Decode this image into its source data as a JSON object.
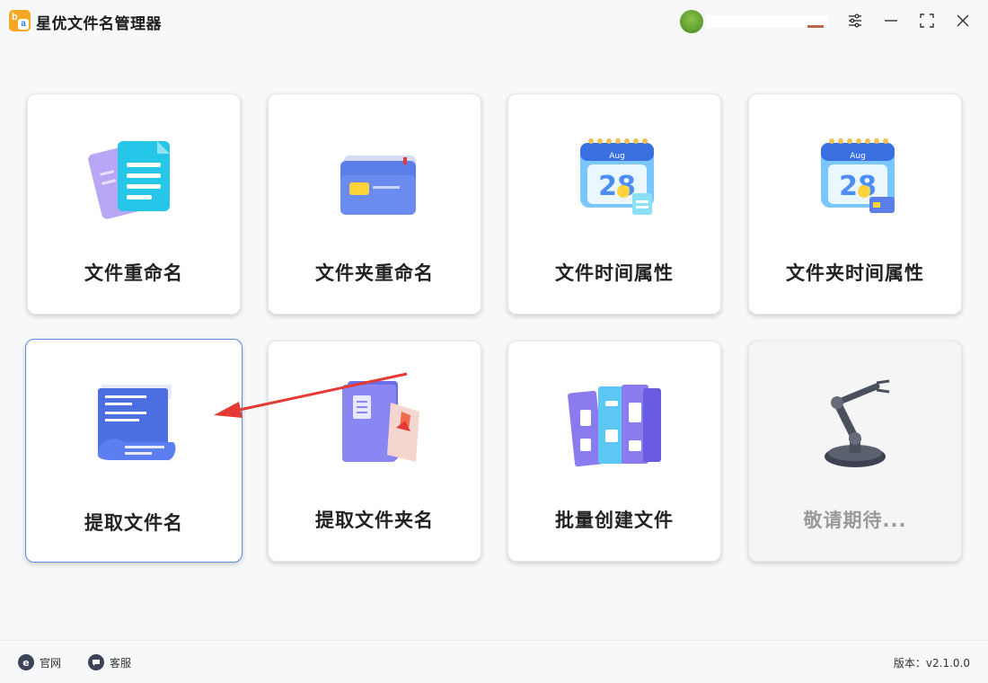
{
  "app": {
    "title": "星优文件名管理器",
    "logo_icon": "app-logo-icon"
  },
  "window_controls": [
    {
      "name": "settings",
      "icon": "sliders-icon"
    },
    {
      "name": "minimize",
      "icon": "minimize-icon"
    },
    {
      "name": "maximize",
      "icon": "maximize-icon"
    },
    {
      "name": "close",
      "icon": "close-icon"
    }
  ],
  "cards": [
    {
      "label": "文件重命名",
      "icon": "documents-icon"
    },
    {
      "label": "文件夹重命名",
      "icon": "folder-icon"
    },
    {
      "label": "文件时间属性",
      "icon": "calendar-file-icon",
      "calendar_month": "Aug",
      "calendar_day": "28"
    },
    {
      "label": "文件夹时间属性",
      "icon": "calendar-folder-icon",
      "calendar_month": "Aug",
      "calendar_day": "28"
    },
    {
      "label": "提取文件名",
      "icon": "scroll-list-icon",
      "selected": true
    },
    {
      "label": "提取文件夹名",
      "icon": "folder-extract-icon"
    },
    {
      "label": "批量创建文件",
      "icon": "binders-icon"
    },
    {
      "label": "敬请期待...",
      "icon": "robot-arm-icon",
      "disabled": true
    }
  ],
  "footer": {
    "website_label": "官网",
    "support_label": "客服",
    "version_text": "版本：v2.1.0.0"
  },
  "colors": {
    "accent": "#5b8ee6",
    "arrow": "#e53935",
    "logo": "#f5a623"
  }
}
